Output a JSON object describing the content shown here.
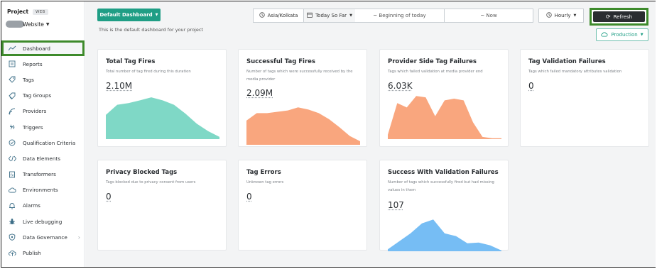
{
  "sidebar": {
    "project_label": "Project",
    "project_badge": "WEB",
    "site_name": "Website",
    "items": [
      {
        "label": "Dashboard",
        "icon": "trend-icon"
      },
      {
        "label": "Reports",
        "icon": "report-icon"
      },
      {
        "label": "Tags",
        "icon": "tag-icon"
      },
      {
        "label": "Tag Groups",
        "icon": "tag-group-icon"
      },
      {
        "label": "Providers",
        "icon": "providers-icon"
      },
      {
        "label": "Triggers",
        "icon": "triggers-icon"
      },
      {
        "label": "Qualification Criteria",
        "icon": "check-circle-icon"
      },
      {
        "label": "Data Elements",
        "icon": "code-icon"
      },
      {
        "label": "Transformers",
        "icon": "transformer-icon"
      },
      {
        "label": "Environments",
        "icon": "cloud-icon"
      },
      {
        "label": "Alarms",
        "icon": "bell-icon"
      },
      {
        "label": "Live debugging",
        "icon": "bug-icon"
      },
      {
        "label": "Data Governance",
        "icon": "shield-icon"
      },
      {
        "label": "Publish",
        "icon": "upload-icon"
      }
    ]
  },
  "header": {
    "dashboard_select": "Default Dashboard",
    "subtitle": "This is the default dashboard for your project",
    "timezone": "Asia/Kolkata",
    "range": "Today So Far",
    "from": "~ Beginning of today",
    "to": "~ Now",
    "interval": "Hourly",
    "refresh_label": "Refresh",
    "environment": "Production"
  },
  "colors": {
    "accent": "#1f9e85",
    "highlight_border": "#3d8a2b",
    "teal": "#7fd8c6",
    "orange": "#f9a67e",
    "blue": "#76bdf4"
  },
  "cards": [
    {
      "title": "Total Tag Fires",
      "desc": "Total number of tag fired during this duration",
      "value": "2.10M",
      "color": "#7fd8c6",
      "series": [
        0.55,
        0.78,
        0.82,
        0.88,
        0.95,
        0.88,
        0.78,
        0.58,
        0.35,
        0.18,
        0.05
      ]
    },
    {
      "title": "Successful Tag Fires",
      "desc": "Number of tags which were successfully received by the media provider",
      "value": "2.09M",
      "color": "#f9a67e",
      "series": [
        0.55,
        0.72,
        0.72,
        0.75,
        0.78,
        0.85,
        0.8,
        0.72,
        0.58,
        0.4,
        0.2,
        0.08
      ]
    },
    {
      "title": "Provider Side Tag Failures",
      "desc": "Tags which failed validation at media provider end",
      "value": "6.03K",
      "color": "#f9a67e",
      "series": [
        0.1,
        0.82,
        0.72,
        0.98,
        0.95,
        0.52,
        0.88,
        0.92,
        0.88,
        0.38,
        0.05,
        0.02,
        0.02
      ]
    },
    {
      "title": "Tag Validation Failures",
      "desc": "Tags which failed mandatory attributes validation",
      "value": "0",
      "color": "#7fd8c6",
      "series": []
    },
    {
      "title": "Privacy Blocked Tags",
      "desc": "Tags blocked due to privacy consent from users",
      "value": "0",
      "color": "#7fd8c6",
      "series": []
    },
    {
      "title": "Tag Errors",
      "desc": "Unknown tag errors",
      "value": "0",
      "color": "#7fd8c6",
      "series": []
    },
    {
      "title": "Success With Validation Failures",
      "desc": "Number of tags which successfully fired but had missing values in them",
      "value": "107",
      "color": "#76bdf4",
      "series": [
        0.05,
        0.25,
        0.45,
        0.7,
        0.8,
        0.45,
        0.38,
        0.2,
        0.22,
        0.15,
        0.02
      ]
    }
  ]
}
